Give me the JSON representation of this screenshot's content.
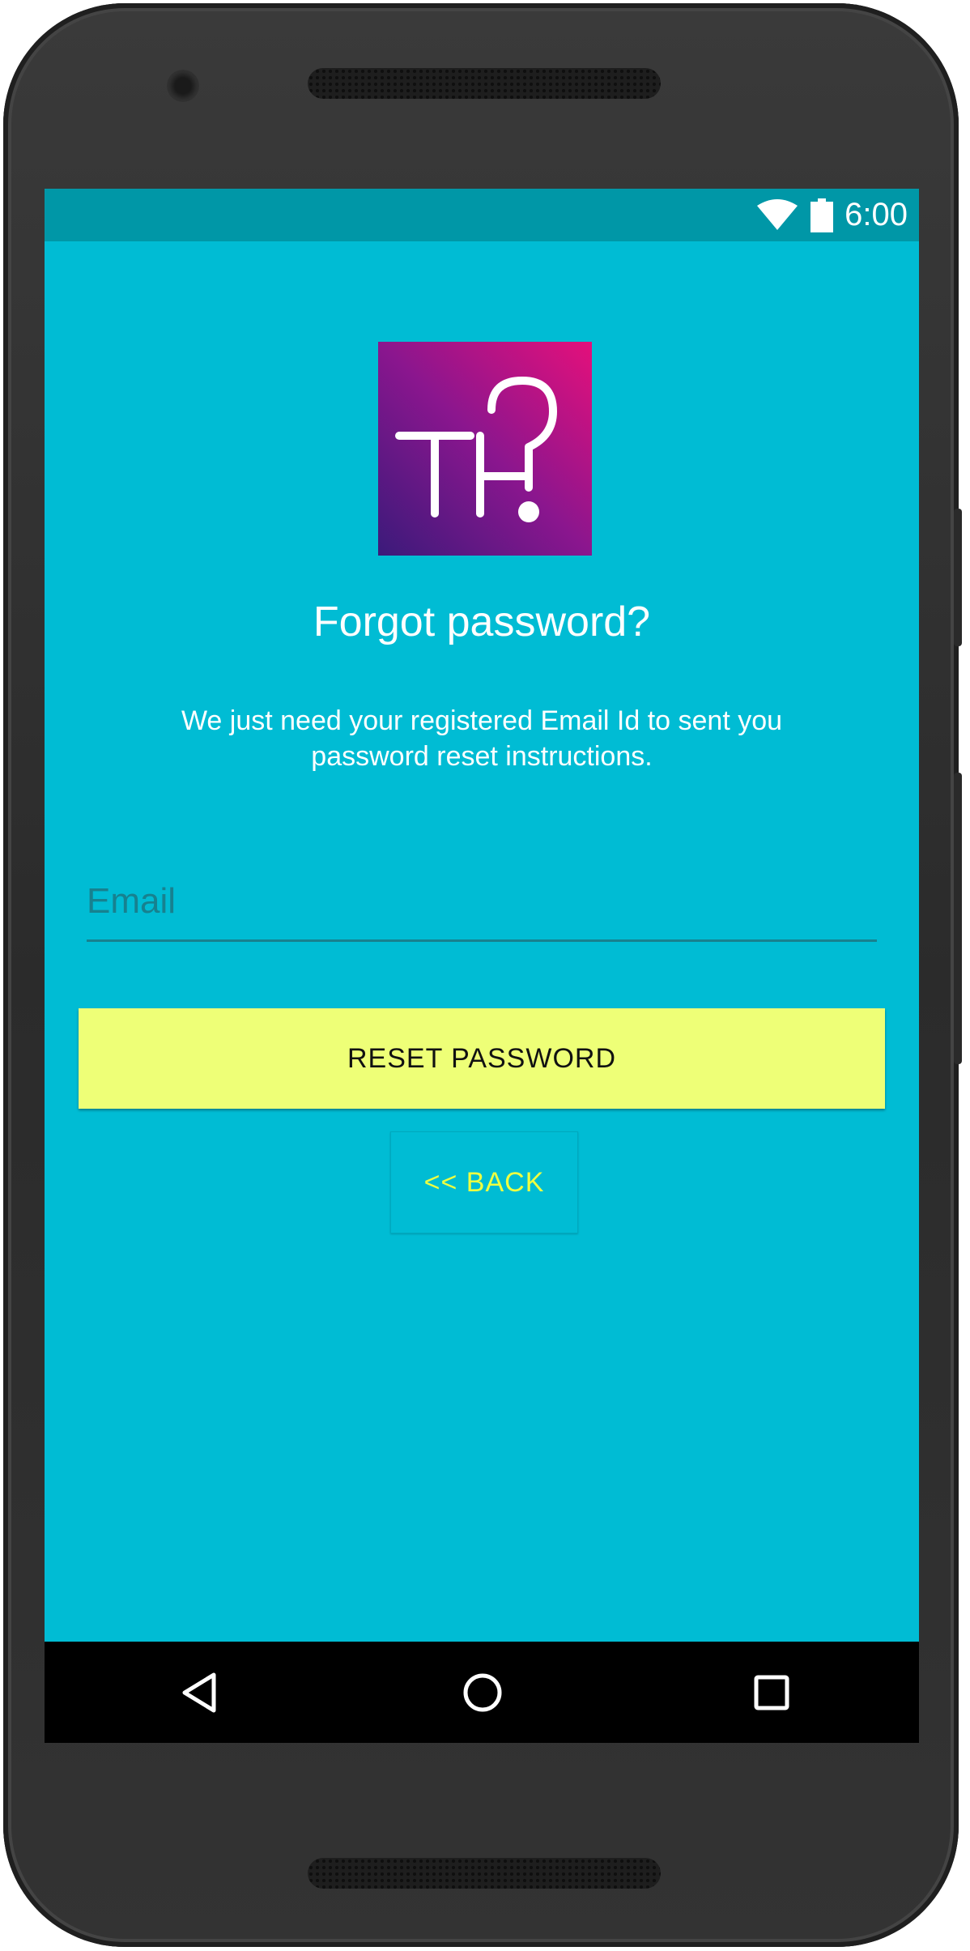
{
  "status_bar": {
    "time": "6:00",
    "icons": [
      "wifi-icon",
      "battery-icon"
    ],
    "color": "#0097a7"
  },
  "logo": {
    "text": "TH?",
    "gradient": [
      "#3b1a7a",
      "#8a168e",
      "#e4107b"
    ]
  },
  "screen": {
    "title": "Forgot password?",
    "subtitle": "We just need your registered Email Id to sent you password reset instructions.",
    "background": "#00bcd4"
  },
  "email_field": {
    "placeholder": "Email",
    "value": ""
  },
  "reset_button": {
    "label": "RESET PASSWORD",
    "color": "#eeff77"
  },
  "back_button": {
    "label": "<< BACK",
    "text_color": "#eeff41"
  },
  "nav_bar": {
    "icons": [
      "back-triangle-icon",
      "home-circle-icon",
      "recents-square-icon"
    ]
  }
}
